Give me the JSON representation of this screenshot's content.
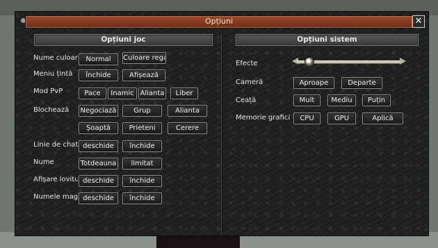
{
  "window": {
    "title": "Opțiuni",
    "close_label": "✕"
  },
  "game_options": {
    "header": "Opțiuni joc",
    "rows": [
      {
        "label": "Nume culoare",
        "buttons": [
          "Normal",
          "Culoare regat"
        ]
      },
      {
        "label": "Meniu țintă",
        "buttons": [
          "Închide",
          "Afișează"
        ]
      },
      {
        "label": "Mod PvP",
        "buttons": [
          "Pace",
          "Inamic",
          "Alianta",
          "Liber"
        ]
      },
      {
        "label": "Blochează",
        "buttons": [
          "Negociază",
          "Grup",
          "Alianta"
        ]
      },
      {
        "label": "",
        "buttons": [
          "Șoaptă",
          "Prieteni",
          "Cerere"
        ]
      },
      {
        "label": "Linie de chat",
        "buttons": [
          "deschide",
          "închide"
        ]
      },
      {
        "label": "Nume",
        "buttons": [
          "Totdeauna",
          "limitat"
        ]
      },
      {
        "label": "Afișare lovituri",
        "buttons": [
          "deschide",
          "închide"
        ]
      },
      {
        "label": "Numele magazin",
        "buttons": [
          "deschide",
          "închide"
        ]
      }
    ]
  },
  "system_options": {
    "header": "Opțiuni sistem",
    "effects_label": "Efecte",
    "effects_level": 0.1,
    "camera": {
      "label": "Cameră",
      "buttons": [
        "Aproape",
        "Departe"
      ]
    },
    "fog": {
      "label": "Ceață",
      "buttons": [
        "Mult",
        "Mediu",
        "Puțin"
      ]
    },
    "graphics_memory": {
      "label": "Memorie grafică",
      "buttons": [
        "CPU",
        "GPU",
        "Aplică"
      ]
    }
  }
}
